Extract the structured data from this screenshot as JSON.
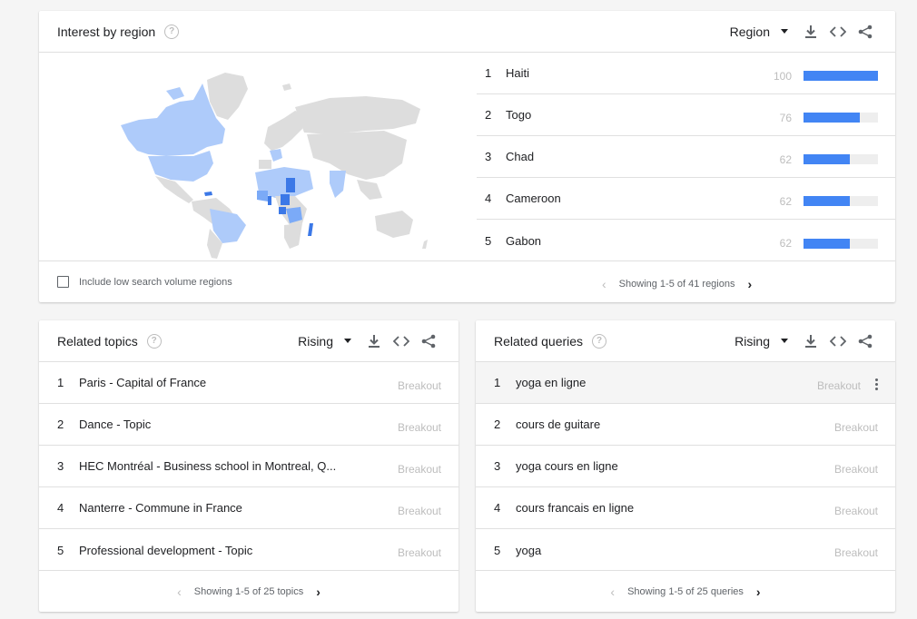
{
  "region": {
    "title": "Interest by region",
    "help_icon": "?",
    "dropdown_label": "Region",
    "rows": [
      {
        "rank": "1",
        "name": "Haiti",
        "score": "100",
        "fill": 1.0
      },
      {
        "rank": "2",
        "name": "Togo",
        "score": "76",
        "fill": 0.76
      },
      {
        "rank": "3",
        "name": "Chad",
        "score": "62",
        "fill": 0.62
      },
      {
        "rank": "4",
        "name": "Cameroon",
        "score": "62",
        "fill": 0.62
      },
      {
        "rank": "5",
        "name": "Gabon",
        "score": "62",
        "fill": 0.62
      }
    ],
    "checkbox_label": "Include low search volume regions",
    "pager_text": "Showing 1-5 of 41 regions"
  },
  "topics": {
    "title": "Related topics",
    "help_icon": "?",
    "dropdown_label": "Rising",
    "rows": [
      {
        "rank": "1",
        "name": "Paris - Capital of France",
        "value": "Breakout"
      },
      {
        "rank": "2",
        "name": "Dance - Topic",
        "value": "Breakout"
      },
      {
        "rank": "3",
        "name": "HEC Montréal - Business school in Montreal, Q...",
        "value": "Breakout"
      },
      {
        "rank": "4",
        "name": "Nanterre - Commune in France",
        "value": "Breakout"
      },
      {
        "rank": "5",
        "name": "Professional development - Topic",
        "value": "Breakout"
      }
    ],
    "pager_text": "Showing 1-5 of 25 topics"
  },
  "queries": {
    "title": "Related queries",
    "help_icon": "?",
    "dropdown_label": "Rising",
    "rows": [
      {
        "rank": "1",
        "name": "yoga en ligne",
        "value": "Breakout"
      },
      {
        "rank": "2",
        "name": "cours de guitare",
        "value": "Breakout"
      },
      {
        "rank": "3",
        "name": "yoga cours en ligne",
        "value": "Breakout"
      },
      {
        "rank": "4",
        "name": "cours francais en ligne",
        "value": "Breakout"
      },
      {
        "rank": "5",
        "name": "yoga",
        "value": "Breakout"
      }
    ],
    "pager_text": "Showing 1-5 of 25 queries"
  },
  "pager_prev": "‹",
  "pager_next": "›",
  "colors": {
    "accent": "#4285f4",
    "map_high": "#3b78e7",
    "map_mid": "#7baaf7",
    "map_low": "#aecbfa",
    "map_none": "#dddddd"
  },
  "icons": [
    "help-icon",
    "caret-down-icon",
    "download-icon",
    "embed-code-icon",
    "share-icon",
    "chevron-left-icon",
    "chevron-right-icon",
    "more-vert-icon"
  ]
}
